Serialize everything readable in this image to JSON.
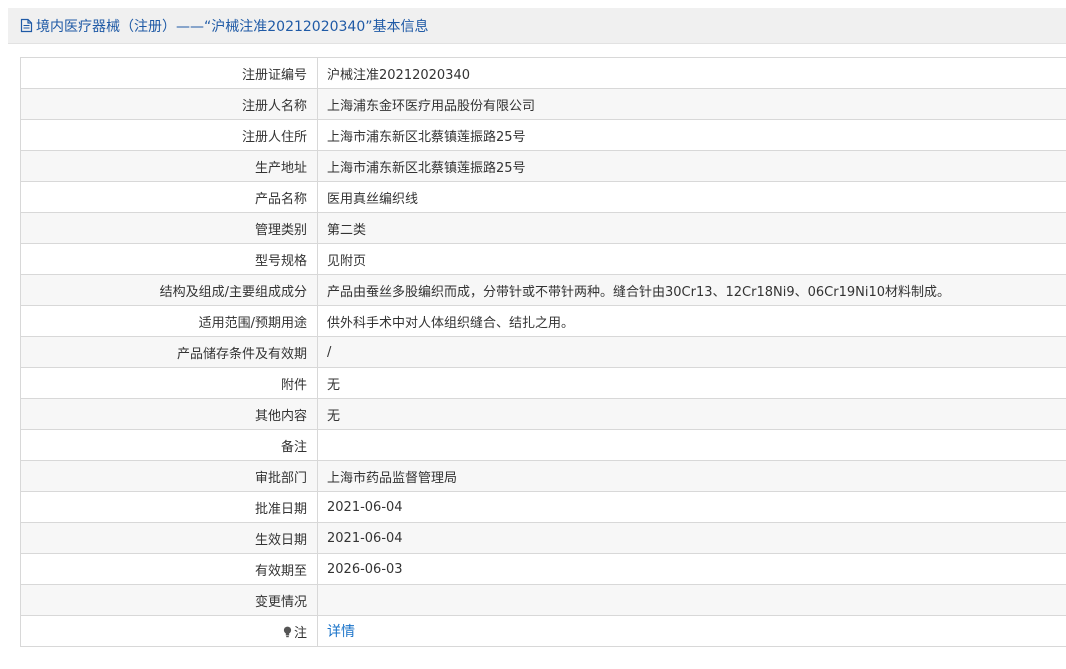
{
  "header": {
    "title": "境内医疗器械（注册）——“沪械注准20212020340”基本信息",
    "icon": "document-icon"
  },
  "rows": [
    {
      "label": "注册证编号",
      "value": "沪械注准20212020340"
    },
    {
      "label": "注册人名称",
      "value": "上海浦东金环医疗用品股份有限公司"
    },
    {
      "label": "注册人住所",
      "value": "上海市浦东新区北蔡镇莲振路25号"
    },
    {
      "label": "生产地址",
      "value": "上海市浦东新区北蔡镇莲振路25号"
    },
    {
      "label": "产品名称",
      "value": "医用真丝编织线"
    },
    {
      "label": "管理类别",
      "value": "第二类"
    },
    {
      "label": "型号规格",
      "value": "见附页"
    },
    {
      "label": "结构及组成/主要组成成分",
      "value": "产品由蚕丝多股编织而成，分带针或不带针两种。缝合针由30Cr13、12Cr18Ni9、06Cr19Ni10材料制成。"
    },
    {
      "label": "适用范围/预期用途",
      "value": "供外科手术中对人体组织缝合、结扎之用。"
    },
    {
      "label": "产品储存条件及有效期",
      "value": "/"
    },
    {
      "label": "附件",
      "value": "无"
    },
    {
      "label": "其他内容",
      "value": "无"
    },
    {
      "label": "备注",
      "value": ""
    },
    {
      "label": "审批部门",
      "value": "上海市药品监督管理局"
    },
    {
      "label": "批准日期",
      "value": "2021-06-04"
    },
    {
      "label": "生效日期",
      "value": "2021-06-04"
    },
    {
      "label": "有效期至",
      "value": "2026-06-03"
    },
    {
      "label": "变更情况",
      "value": ""
    }
  ],
  "note_row": {
    "label": "注",
    "link": "详情",
    "icon": "lightbulb-icon"
  },
  "colors": {
    "title": "#1f5aa6",
    "link": "#1a73c9",
    "border": "#d8d8d8",
    "stripe": "#f7f7f7"
  }
}
